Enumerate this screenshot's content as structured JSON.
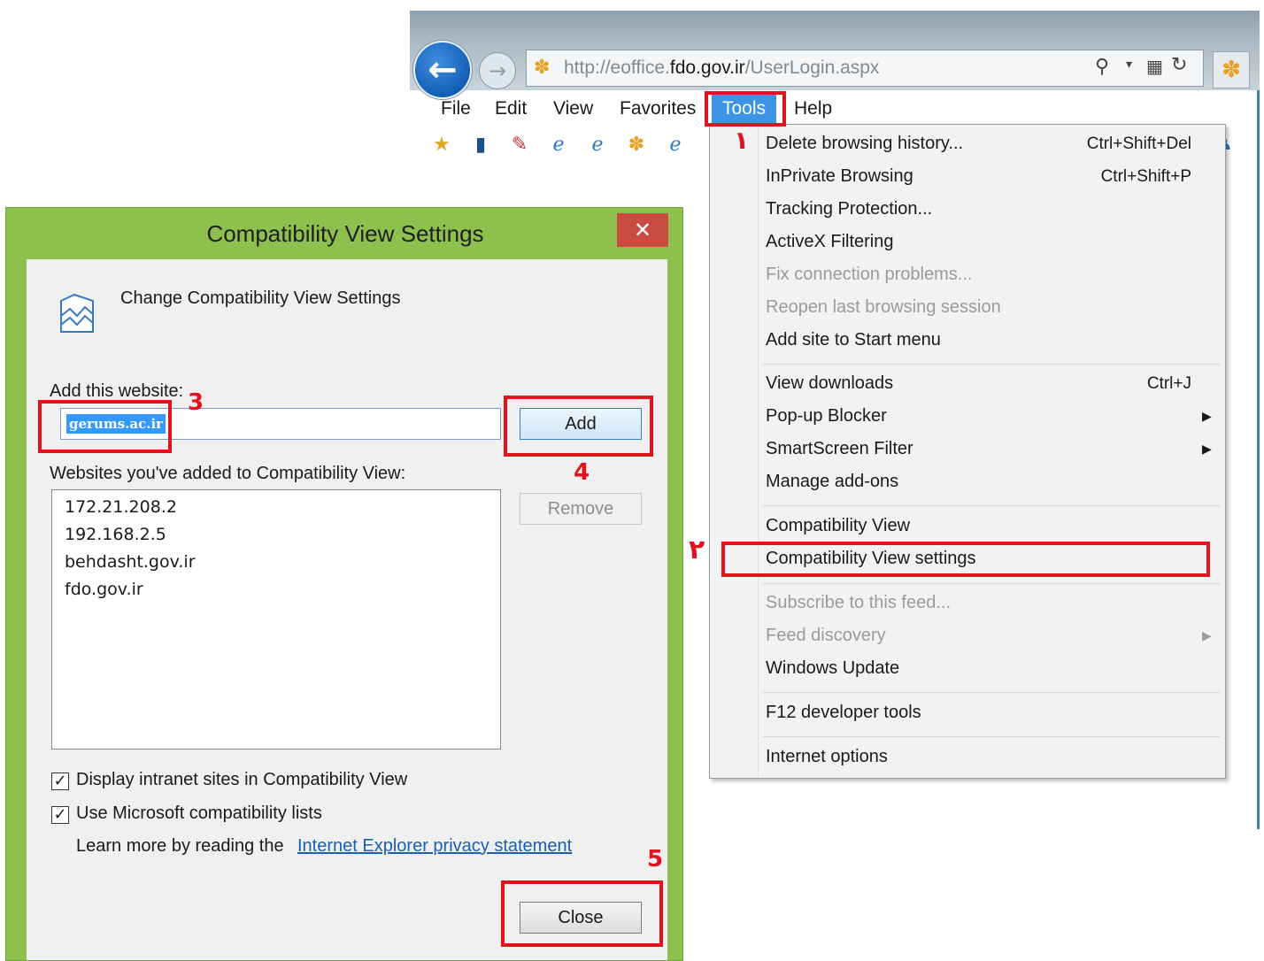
{
  "browser": {
    "url_prefix": "http://eoffice.",
    "url_domain": "fdo.gov.ir",
    "url_suffix": "/UserLogin.aspx",
    "menu": [
      "File",
      "Edit",
      "View",
      "Favorites",
      "Tools",
      "Help"
    ]
  },
  "tools_menu": {
    "items": [
      {
        "label": "Delete browsing history...",
        "shortcut": "Ctrl+Shift+Del"
      },
      {
        "label": "InPrivate Browsing",
        "shortcut": "Ctrl+Shift+P"
      },
      {
        "label": "Tracking Protection..."
      },
      {
        "label": "ActiveX Filtering"
      },
      {
        "label": "Fix connection problems..."
      },
      {
        "label": "Reopen last browsing session"
      },
      {
        "label": "Add site to Start menu"
      },
      {
        "label": "View downloads",
        "shortcut": "Ctrl+J"
      },
      {
        "label": "Pop-up Blocker"
      },
      {
        "label": "SmartScreen Filter"
      },
      {
        "label": "Manage add-ons"
      },
      {
        "label": "Compatibility View"
      },
      {
        "label": "Compatibility View settings"
      },
      {
        "label": "Subscribe to this feed..."
      },
      {
        "label": "Feed discovery"
      },
      {
        "label": "Windows Update"
      },
      {
        "label": "F12 developer tools"
      },
      {
        "label": "Internet options"
      }
    ]
  },
  "dialog": {
    "title": "Compatibility View Settings",
    "close_glyph": "✕",
    "header": "Change Compatibility View Settings",
    "add_label": "Add this website:",
    "input_value": "gerums.ac.ir",
    "add_button": "Add",
    "list_label": "Websites you've added to Compatibility View:",
    "sites": [
      "172.21.208.2",
      "192.168.2.5",
      "behdasht.gov.ir",
      "fdo.gov.ir"
    ],
    "remove_button": "Remove",
    "checkbox_intranet": {
      "label": "Display intranet sites in Compatibility View",
      "checked": true
    },
    "checkbox_ms_lists": {
      "label": "Use Microsoft compatibility lists",
      "checked": true
    },
    "learn_more": "Learn more by reading the",
    "privacy_link": "Internet Explorer privacy statement",
    "close_button": "Close"
  },
  "annotations": {
    "step1": "۱",
    "step2": "۲",
    "step3": "3",
    "step4": "4",
    "step5": "5",
    "color": "#e0131e"
  },
  "colors": {
    "dialog_frame": "#8dc04d",
    "close_red": "#c94b41",
    "menu_highlight": "#3e94e4"
  }
}
